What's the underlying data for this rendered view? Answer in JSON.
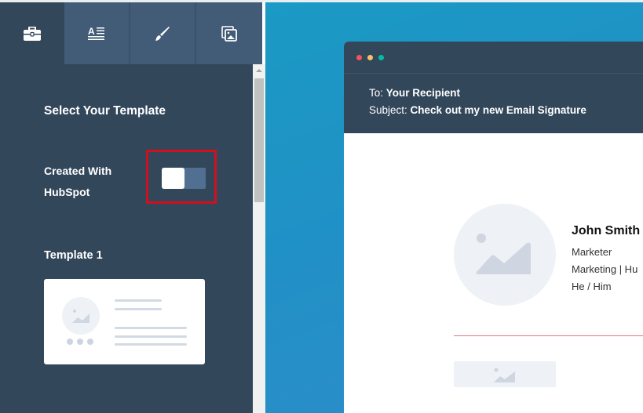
{
  "sidebar": {
    "tabs": [
      {
        "name": "templates",
        "icon": "briefcase-icon",
        "active": true
      },
      {
        "name": "text",
        "icon": "text-format-icon",
        "active": false
      },
      {
        "name": "style",
        "icon": "paintbrush-icon",
        "active": false
      },
      {
        "name": "images",
        "icon": "image-copy-icon",
        "active": false
      }
    ],
    "section_title": "Select Your Template",
    "toggle": {
      "label_line1": "Created With",
      "label_line2": "HubSpot",
      "checked": false
    },
    "template": {
      "title": "Template 1"
    }
  },
  "preview": {
    "window_dots": [
      "#f2545b",
      "#f5c26b",
      "#00bda5"
    ],
    "to_label": "To:",
    "to_value": "Your Recipient",
    "subject_label": "Subject:",
    "subject_value": "Check out my new Email Signature",
    "signature": {
      "name": "John Smith",
      "job_title": "Marketer",
      "department": "Marketing | Hu",
      "pronouns": "He / Him"
    },
    "divider_color": "#e0737e"
  },
  "colors": {
    "sidebar_bg": "#33475b",
    "tab_bg": "#425b76",
    "highlight_border": "#d0101e",
    "preview_bg": "#1f96c6"
  }
}
